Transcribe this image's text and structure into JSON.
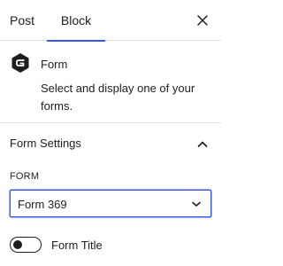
{
  "tabs": {
    "post_label": "Post",
    "block_label": "Block",
    "active": "Block"
  },
  "block": {
    "icon": "gravity-forms-icon",
    "title": "Form",
    "description": "Select and display one of your forms."
  },
  "settings": {
    "title": "Form Settings",
    "expanded": true,
    "form_field": {
      "label": "FORM",
      "selected": "Form 369"
    },
    "toggle": {
      "label": "Form Title",
      "checked": false
    }
  },
  "colors": {
    "accent": "#3858e9",
    "text": "#1e1e1e",
    "divider": "#e0e0e0"
  }
}
